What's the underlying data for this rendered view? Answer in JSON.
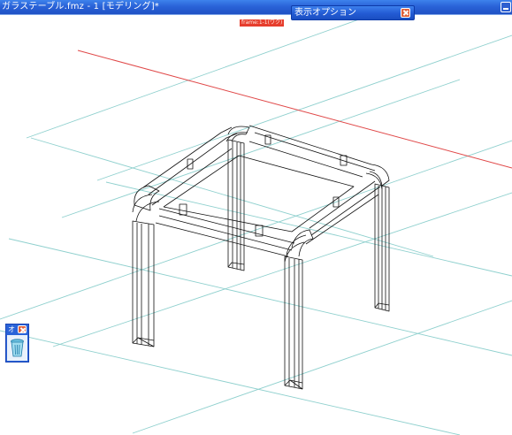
{
  "window": {
    "title": "ガラステーブル.fmz - 1 [モデリング]*"
  },
  "viewport": {
    "frame_label": "frame:1-1(ワク)"
  },
  "option_panel": {
    "title": "表示オプション"
  },
  "mini_panel": {
    "title": "オ"
  },
  "icons": {
    "close": "close-icon",
    "minimize": "minimize-icon",
    "trash": "trash-bin-icon"
  },
  "colors": {
    "titlebar": "#2a63d8",
    "axis_red": "#e04848",
    "grid": "#8fd0ce",
    "model": "#000000"
  }
}
